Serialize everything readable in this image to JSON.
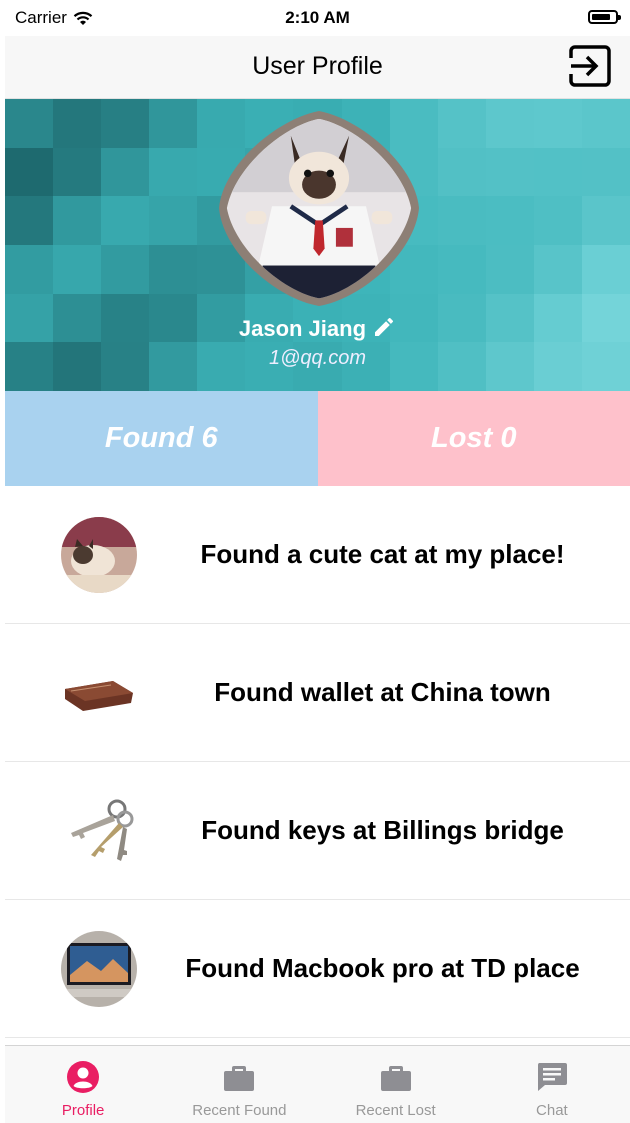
{
  "status_bar": {
    "carrier": "Carrier",
    "time": "2:10 AM"
  },
  "nav": {
    "title": "User Profile",
    "logout_icon": "logout-icon"
  },
  "profile": {
    "name": "Jason Jiang",
    "email": "1@qq.com",
    "edit_icon": "pencil-icon"
  },
  "tabs": {
    "found_label": "Found 6",
    "lost_label": "Lost 0"
  },
  "items": [
    {
      "title": "Found a cute cat at my place!",
      "thumb": "cat"
    },
    {
      "title": "Found wallet at China town",
      "thumb": "wallet"
    },
    {
      "title": "Found keys at Billings bridge",
      "thumb": "keys"
    },
    {
      "title": "Found Macbook pro at TD place",
      "thumb": "laptop"
    }
  ],
  "tabbar": {
    "items": [
      {
        "label": "Profile",
        "icon": "profile-icon",
        "active": true
      },
      {
        "label": "Recent Found",
        "icon": "briefcase-icon",
        "active": false
      },
      {
        "label": "Recent Lost",
        "icon": "briefcase-icon",
        "active": false
      },
      {
        "label": "Chat",
        "icon": "chat-icon",
        "active": false
      }
    ]
  },
  "colors": {
    "found_tab": "#a9d2ef",
    "lost_tab": "#fec1cb",
    "accent": "#e91e63",
    "hero": "#4fbdbd"
  }
}
